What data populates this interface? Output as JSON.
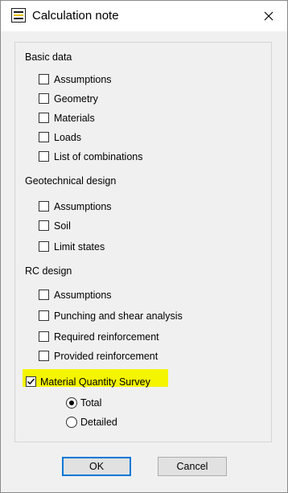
{
  "window": {
    "title": "Calculation note"
  },
  "sections": {
    "basic": {
      "header": "Basic data",
      "items": [
        {
          "label": "Assumptions",
          "checked": false
        },
        {
          "label": "Geometry",
          "checked": false
        },
        {
          "label": "Materials",
          "checked": false
        },
        {
          "label": "Loads",
          "checked": false
        },
        {
          "label": "List of combinations",
          "checked": false
        }
      ]
    },
    "geo": {
      "header": "Geotechnical design",
      "items": [
        {
          "label": "Assumptions",
          "checked": false
        },
        {
          "label": "Soil",
          "checked": false
        },
        {
          "label": "Limit states",
          "checked": false
        }
      ]
    },
    "rc": {
      "header": "RC design",
      "items": [
        {
          "label": "Assumptions",
          "checked": false
        },
        {
          "label": "Punching and shear analysis",
          "checked": false
        },
        {
          "label": "Required reinforcement",
          "checked": false
        },
        {
          "label": "Provided reinforcement",
          "checked": false
        }
      ]
    }
  },
  "mqs": {
    "label": "Material Quantity Survey",
    "checked": true,
    "options": [
      {
        "label": "Total",
        "selected": true
      },
      {
        "label": "Detailed",
        "selected": false
      }
    ]
  },
  "buttons": {
    "ok": "OK",
    "cancel": "Cancel"
  },
  "colors": {
    "highlight": "#f5f500",
    "accent": "#0078d7"
  }
}
